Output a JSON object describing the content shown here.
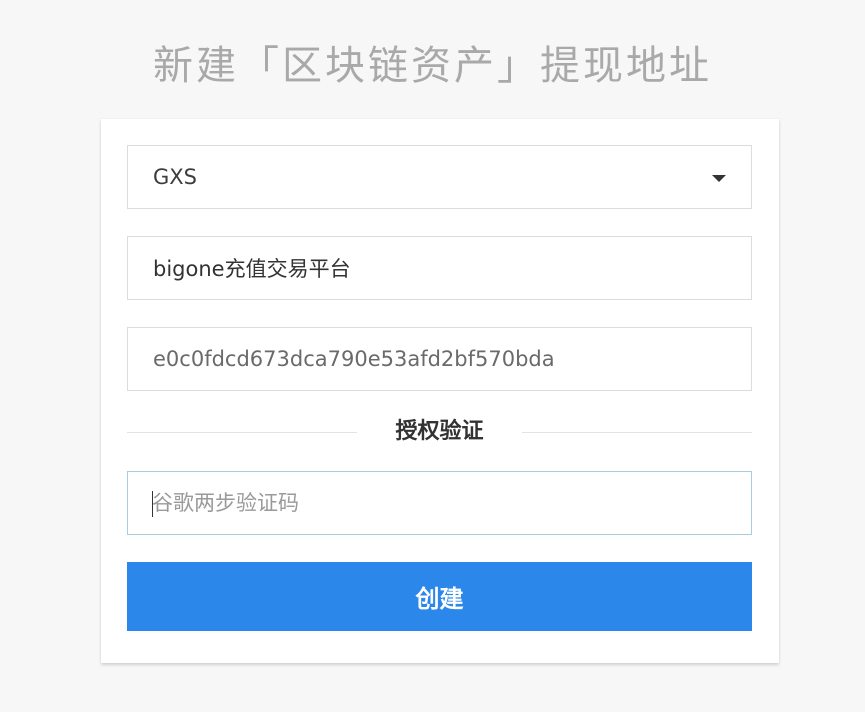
{
  "page": {
    "title": "新建「区块链资产」提现地址"
  },
  "form": {
    "asset_select": {
      "selected": "GXS"
    },
    "name_field": {
      "value": "bigone充值交易平台"
    },
    "address_field": {
      "value": "e0c0fdcd673dca790e53afd2bf570bda"
    },
    "auth_section_label": "授权验证",
    "code_input": {
      "placeholder": "谷歌两步验证码",
      "value": ""
    },
    "create_button_label": "创建"
  },
  "colors": {
    "primary_button": "#2c87ea",
    "page_background": "#f7f7f7",
    "title_text": "#a9a9a9",
    "focus_border": "#a9cce3"
  },
  "icons": {
    "select_caret": "caret-down-icon"
  }
}
